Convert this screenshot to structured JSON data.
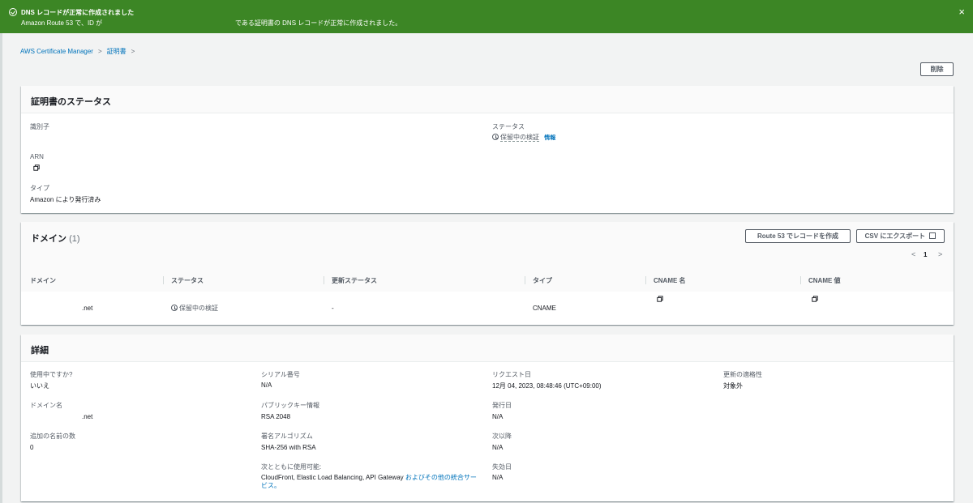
{
  "banner": {
    "title": "DNS レコードが正常に作成されました",
    "message_part1": "Amazon Route 53 で、ID が",
    "message_part2": "である証明書の DNS レコードが正常に作成されました。",
    "close_glyph": "×"
  },
  "breadcrumb": {
    "items": [
      "AWS Certificate Manager",
      "証明書"
    ],
    "separator": ">"
  },
  "actions": {
    "delete_label": "削除"
  },
  "status_section": {
    "title": "証明書のステータス",
    "identifier_label": "識別子",
    "arn_label": "ARN",
    "type_label": "タイプ",
    "type_value": "Amazon により発行済み",
    "status_label": "ステータス",
    "status_value": "保留中の検証",
    "info_link": "情報"
  },
  "domains_section": {
    "title": "ドメイン",
    "count": "(1)",
    "create_route53_label": "Route 53 でレコードを作成",
    "export_csv_label": "CSV にエクスポート",
    "pagination": {
      "prev": "<",
      "page": "1",
      "next": ">"
    },
    "columns": [
      "ドメイン",
      "ステータス",
      "更新ステータス",
      "タイプ",
      "CNAME 名",
      "CNAME 値"
    ],
    "rows": [
      {
        "domain": ".net",
        "status": "保留中の検証",
        "renewal_status": "-",
        "type": "CNAME"
      }
    ]
  },
  "details_section": {
    "title": "詳細",
    "in_use_label": "使用中ですか?",
    "in_use_value": "いいえ",
    "domain_name_label": "ドメイン名",
    "domain_name_value": ".net",
    "additional_names_label": "追加の名前の数",
    "additional_names_value": "0",
    "serial_label": "シリアル番号",
    "serial_value": "N/A",
    "public_key_label": "パブリックキー情報",
    "public_key_value": "RSA 2048",
    "signature_label": "署名アルゴリズム",
    "signature_value": "SHA-256 with RSA",
    "usable_with_label": "次とともに使用可能:",
    "usable_with_value": "CloudFront, Elastic Load Balancing, API Gateway",
    "usable_with_link_1": "およびその他の統合サー",
    "usable_with_link_2": "ビス。",
    "requested_label": "リクエスト日",
    "requested_value": "12月 04, 2023, 08:48:46 (UTC+09:00)",
    "issued_label": "発行日",
    "issued_value": "N/A",
    "not_before_label": "次以降",
    "not_before_value": "N/A",
    "expires_label": "失効日",
    "expires_value": "N/A",
    "renewal_eligibility_label": "更新の適格性",
    "renewal_eligibility_value": "対象外"
  }
}
